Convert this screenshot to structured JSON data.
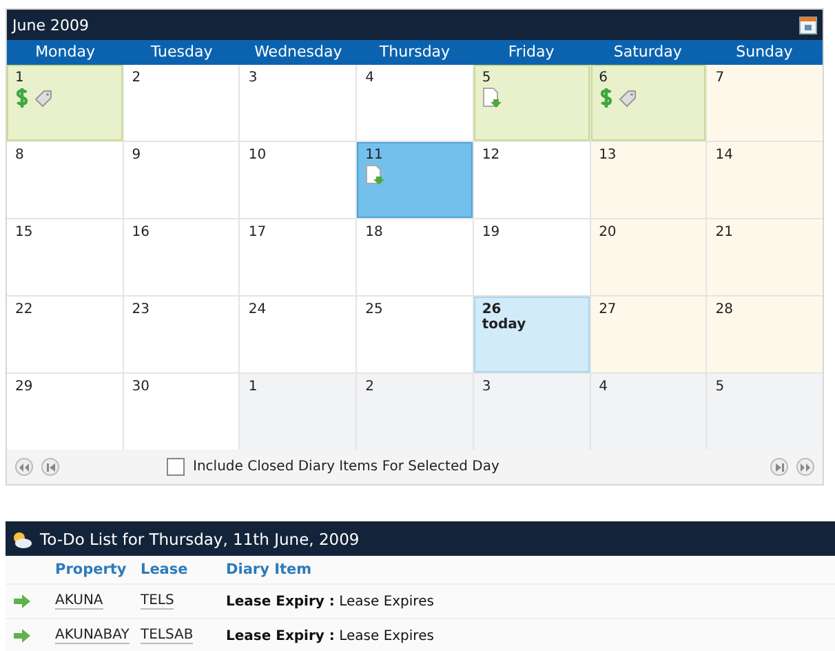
{
  "calendar": {
    "title": "June 2009",
    "weekdays": [
      "Monday",
      "Tuesday",
      "Wednesday",
      "Thursday",
      "Friday",
      "Saturday",
      "Sunday"
    ],
    "weeks": [
      [
        {
          "day": "1",
          "kind": "event",
          "selected": false,
          "icons": [
            {
              "kind": "dollar"
            },
            {
              "kind": "tag"
            }
          ]
        },
        {
          "day": "2",
          "kind": "normal",
          "selected": false
        },
        {
          "day": "3",
          "kind": "normal",
          "selected": false
        },
        {
          "day": "4",
          "kind": "normal",
          "selected": false
        },
        {
          "day": "5",
          "kind": "event",
          "selected": false,
          "icons": [
            {
              "kind": "doc"
            }
          ]
        },
        {
          "day": "6",
          "kind": "event",
          "selected": false,
          "icons": [
            {
              "kind": "dollar"
            },
            {
              "kind": "tag"
            }
          ]
        },
        {
          "day": "7",
          "kind": "weekend",
          "selected": false
        }
      ],
      [
        {
          "day": "8",
          "kind": "normal",
          "selected": false
        },
        {
          "day": "9",
          "kind": "normal",
          "selected": false
        },
        {
          "day": "10",
          "kind": "normal",
          "selected": false
        },
        {
          "day": "11",
          "kind": "normal",
          "selected": true,
          "icons": [
            {
              "kind": "doc"
            }
          ]
        },
        {
          "day": "12",
          "kind": "normal",
          "selected": false
        },
        {
          "day": "13",
          "kind": "weekend",
          "selected": false
        },
        {
          "day": "14",
          "kind": "weekend",
          "selected": false
        }
      ],
      [
        {
          "day": "15",
          "kind": "normal",
          "selected": false
        },
        {
          "day": "16",
          "kind": "normal",
          "selected": false
        },
        {
          "day": "17",
          "kind": "normal",
          "selected": false
        },
        {
          "day": "18",
          "kind": "normal",
          "selected": false
        },
        {
          "day": "19",
          "kind": "normal",
          "selected": false
        },
        {
          "day": "20",
          "kind": "weekend",
          "selected": false
        },
        {
          "day": "21",
          "kind": "weekend",
          "selected": false
        }
      ],
      [
        {
          "day": "22",
          "kind": "normal",
          "selected": false
        },
        {
          "day": "23",
          "kind": "normal",
          "selected": false
        },
        {
          "day": "24",
          "kind": "normal",
          "selected": false
        },
        {
          "day": "25",
          "kind": "normal",
          "selected": false
        },
        {
          "day": "26",
          "kind": "today",
          "selected": false,
          "note": "today"
        },
        {
          "day": "27",
          "kind": "weekend",
          "selected": false
        },
        {
          "day": "28",
          "kind": "weekend",
          "selected": false
        }
      ],
      [
        {
          "day": "29",
          "kind": "normal",
          "selected": false
        },
        {
          "day": "30",
          "kind": "normal",
          "selected": false
        },
        {
          "day": "1",
          "kind": "other",
          "selected": false
        },
        {
          "day": "2",
          "kind": "other",
          "selected": false
        },
        {
          "day": "3",
          "kind": "other",
          "selected": false
        },
        {
          "day": "4",
          "kind": "other",
          "selected": false
        },
        {
          "day": "5",
          "kind": "other",
          "selected": false
        }
      ]
    ],
    "include_closed": {
      "label": "Include Closed Diary Items For Selected Day",
      "checked": false
    }
  },
  "todo": {
    "title": "To-Do List for Thursday, 11th June, 2009",
    "columns": [
      "Property",
      "Lease",
      "Diary Item"
    ],
    "rows": [
      {
        "property": "AKUNA",
        "lease": "TELS",
        "item": "**Lease Expiry :** Lease Expires"
      },
      {
        "property": "AKUNABAY",
        "lease": "TELSAB",
        "item": "**Lease Expiry :** Lease Expires"
      }
    ]
  }
}
